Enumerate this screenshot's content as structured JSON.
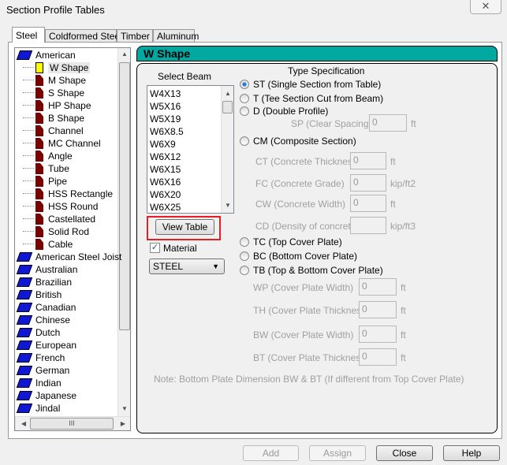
{
  "window": {
    "title": "Section Profile Tables",
    "close": "✕"
  },
  "tabs": [
    "Steel",
    "Coldformed Steel",
    "Timber",
    "Aluminum"
  ],
  "tree": {
    "root": "American",
    "children": [
      "W Shape",
      "M Shape",
      "S Shape",
      "HP Shape",
      "B Shape",
      "Channel",
      "MC Channel",
      "Angle",
      "Tube",
      "Pipe",
      "HSS Rectangle",
      "HSS Round",
      "Castellated",
      "Solid Rod",
      "Cable"
    ],
    "others": [
      "American Steel Joist",
      "Australian",
      "Brazilian",
      "British",
      "Canadian",
      "Chinese",
      "Dutch",
      "European",
      "French",
      "German",
      "Indian",
      "Japanese",
      "Jindal"
    ],
    "hscroll_thumb": "III"
  },
  "header": "W Shape",
  "select_beam": {
    "label": "Select Beam",
    "items": [
      "W4X13",
      "W5X16",
      "W5X19",
      "W6X8.5",
      "W6X9",
      "W6X12",
      "W6X15",
      "W6X16",
      "W6X20",
      "W6X25"
    ]
  },
  "view_table": "View Table",
  "material": {
    "label": "Material",
    "checked": true,
    "value": "STEEL"
  },
  "type_spec": {
    "title": "Type Specification",
    "st": "ST (Single Section from Table)",
    "t": "T (Tee Section Cut from Beam)",
    "d": "D (Double Profile)",
    "sp": {
      "label": "SP (Clear Spacing)",
      "value": "0",
      "unit": "ft"
    },
    "cm": "CM (Composite Section)",
    "ct": {
      "label": "CT (Concrete Thickness)",
      "value": "0",
      "unit": "ft"
    },
    "fc": {
      "label": "FC (Concrete Grade)",
      "value": "0",
      "unit": "kip/ft2"
    },
    "cw": {
      "label": "CW (Concrete Width)",
      "value": "0",
      "unit": "ft"
    },
    "cd": {
      "label": "CD (Density of concrete)",
      "value": "",
      "unit": "kip/ft3"
    },
    "tc": "TC (Top Cover Plate)",
    "bc": "BC (Bottom Cover Plate)",
    "tb": "TB (Top & Bottom Cover Plate)",
    "wp": {
      "label": "WP (Cover Plate Width)",
      "value": "0",
      "unit": "ft"
    },
    "th": {
      "label": "TH (Cover Plate Thickness)",
      "value": "0",
      "unit": "ft"
    },
    "bw": {
      "label": "BW (Cover Plate Width)",
      "value": "0",
      "unit": "ft"
    },
    "bt": {
      "label": "BT (Cover Plate Thickness)",
      "value": "0",
      "unit": "ft"
    },
    "note": "Note: Bottom Plate Dimension BW & BT (If different from Top Cover Plate)"
  },
  "buttons": {
    "add": "Add",
    "assign": "Assign",
    "close": "Close",
    "help": "Help"
  },
  "colors": {
    "header": "#00a8a0",
    "highlight": "#e81c24"
  }
}
